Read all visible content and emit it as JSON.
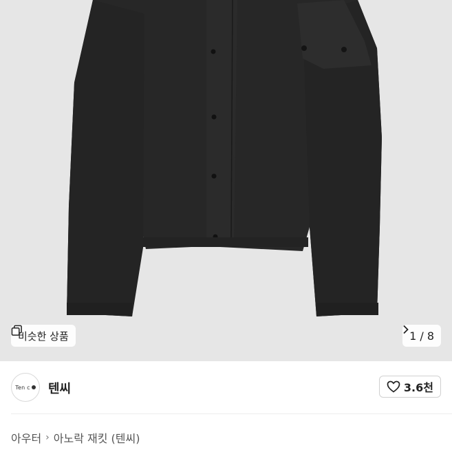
{
  "product": {
    "image_alt": "black jacket",
    "similar_button_label": "비슷한 상품",
    "image_counter": "1 / 8"
  },
  "shop": {
    "avatar_logo_text": "Ten c",
    "name": "텐씨",
    "follow_count": "3.6천"
  },
  "breadcrumb": {
    "category": "아우터",
    "title": "아노락 재킷 (텐씨)"
  },
  "colors": {
    "jacket": "#262626",
    "background": "#e6e6e6"
  },
  "icons": {
    "similar": "stacked-squares-icon",
    "counter_next": "chevron-right-icon",
    "follow": "heart-outline-icon",
    "breadcrumb_sep": "chevron-right-icon"
  }
}
